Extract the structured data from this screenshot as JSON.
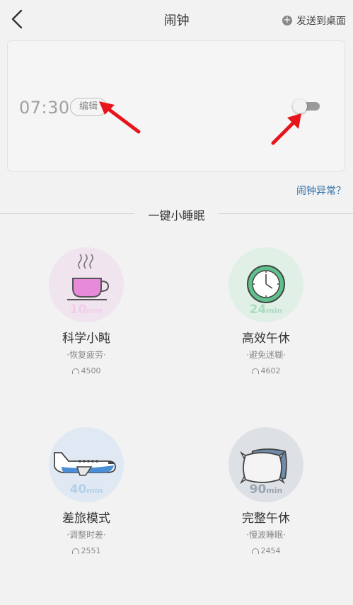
{
  "header": {
    "title": "闹钟",
    "send_to_desktop": "发送到桌面"
  },
  "alarm": {
    "time": "07:30",
    "edit_label": "编辑",
    "enabled": false
  },
  "alarm_issue_link": "闹钟异常？",
  "section_title": "一键小睡眠",
  "naps": [
    {
      "minutes": "10",
      "unit": "min",
      "name": "科学小盹",
      "subtitle": "·恢复疲劳·",
      "count": "4500",
      "icon": "coffee-cup-icon",
      "color": "#f0e4ee",
      "accent": "#f2cdea"
    },
    {
      "minutes": "24",
      "unit": "min",
      "name": "高效午休",
      "subtitle": "·避免迷糊·",
      "count": "4602",
      "icon": "clock-icon",
      "color": "#e1f0e7",
      "accent": "#aadcc0"
    },
    {
      "minutes": "40",
      "unit": "min",
      "name": "差旅模式",
      "subtitle": "·调整时差·",
      "count": "2551",
      "icon": "airplane-icon",
      "color": "#e0e9f3",
      "accent": "#b3cfe9"
    },
    {
      "minutes": "90",
      "unit": "min",
      "name": "完整午休",
      "subtitle": "·慢波睡眠·",
      "count": "2454",
      "icon": "pillow-icon",
      "color": "#dde1e5",
      "accent": "#9aa6b2"
    }
  ],
  "colors": {
    "link": "#2b6fa8",
    "arrow": "#e8141b"
  }
}
